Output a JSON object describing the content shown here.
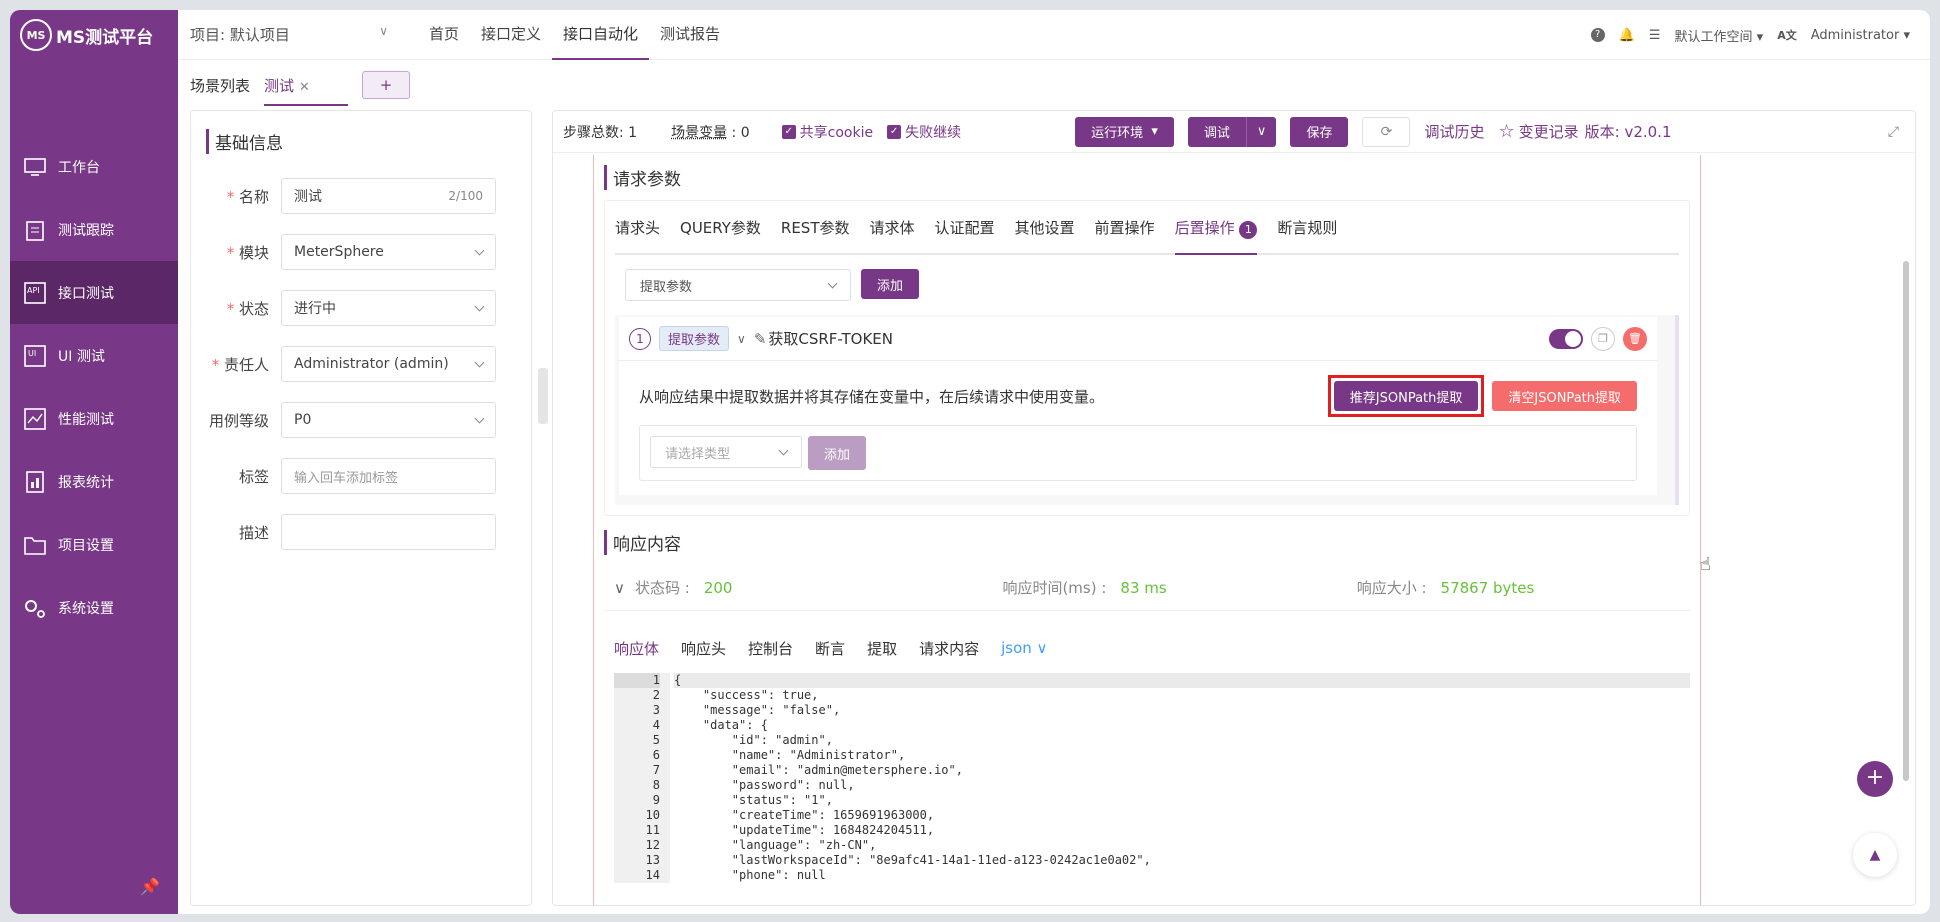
{
  "app": {
    "logo_text": "MS测试平台",
    "logo_mark": "MS"
  },
  "sidebar": {
    "items": [
      {
        "label": "工作台",
        "icon": "monitor-icon"
      },
      {
        "label": "测试跟踪",
        "icon": "clipboard-icon"
      },
      {
        "label": "接口测试",
        "icon": "api-icon"
      },
      {
        "label": "UI 测试",
        "icon": "ui-icon"
      },
      {
        "label": "性能测试",
        "icon": "chart-icon"
      },
      {
        "label": "报表统计",
        "icon": "report-icon"
      },
      {
        "label": "项目设置",
        "icon": "folder-icon"
      },
      {
        "label": "系统设置",
        "icon": "gear-icon"
      }
    ],
    "active_index": 2
  },
  "topbar": {
    "project": "项目: 默认项目",
    "menu": [
      "首页",
      "接口定义",
      "接口自动化",
      "测试报告"
    ],
    "active_menu": 2,
    "workspace": "默认工作空间",
    "user": "Administrator"
  },
  "scene_tabs": {
    "list_label": "场景列表",
    "tab": "测试",
    "add": "+"
  },
  "basic_info": {
    "title": "基础信息",
    "name_label": "名称",
    "name_value": "测试",
    "name_count": "2/100",
    "module_label": "模块",
    "module_value": "MeterSphere",
    "status_label": "状态",
    "status_value": "进行中",
    "owner_label": "责任人",
    "owner_value": "Administrator (admin)",
    "level_label": "用例等级",
    "level_value": "P0",
    "tag_label": "标签",
    "tag_placeholder": "输入回车添加标签",
    "desc_label": "描述"
  },
  "toolbar": {
    "steps_label": "步骤总数:",
    "steps_value": "1",
    "vars_label": "场景变量",
    "vars_sep": ":",
    "vars_value": "0",
    "share_cookie": "共享cookie",
    "fail_continue": "失败继续",
    "env_button": "运行环境",
    "debug_button": "调试",
    "save_button": "保存",
    "history_link": "调试历史",
    "changes_link": "变更记录",
    "version": "版本: v2.0.1"
  },
  "request": {
    "section_title": "请求参数",
    "tabs": [
      "请求头",
      "QUERY参数",
      "REST参数",
      "请求体",
      "认证配置",
      "其他设置",
      "前置操作",
      "后置操作",
      "断言规则"
    ],
    "active_tab": 7,
    "post_badge": "1",
    "extract_select": "提取参数",
    "add_button": "添加",
    "step": {
      "index": "1",
      "tag": "提取参数",
      "name": "获取CSRF-TOKEN",
      "description": "从响应结果中提取数据并将其存储在变量中，在后续请求中使用变量。",
      "recommend_button": "推荐JSONPath提取",
      "clear_button": "清空JSONPath提取",
      "type_placeholder": "请选择类型",
      "add_button": "添加"
    }
  },
  "response": {
    "section_title": "响应内容",
    "status_label": "状态码 :",
    "status_value": "200",
    "time_label": "响应时间(ms) :",
    "time_value": "83 ms",
    "size_label": "响应大小 :",
    "size_value": "57867 bytes",
    "tabs": [
      "响应体",
      "响应头",
      "控制台",
      "断言",
      "提取",
      "请求内容"
    ],
    "format": "json",
    "line_numbers": [
      "1",
      "2",
      "3",
      "4",
      "5",
      "6",
      "7",
      "8",
      "9",
      "10",
      "11",
      "12",
      "13",
      "14"
    ],
    "code_lines": [
      "{",
      "    \"success\": true,",
      "    \"message\": \"false\",",
      "    \"data\": {",
      "        \"id\": \"admin\",",
      "        \"name\": \"Administrator\",",
      "        \"email\": \"admin@metersphere.io\",",
      "        \"password\": null,",
      "        \"status\": \"1\",",
      "        \"createTime\": 1659691963000,",
      "        \"updateTime\": 1684824204511,",
      "        \"language\": \"zh-CN\",",
      "        \"lastWorkspaceId\": \"8e9afc41-14a1-11ed-a123-0242ac1e0a02\",",
      "        \"phone\": null"
    ]
  },
  "colors": {
    "brand": "#783887",
    "success": "#67c23a",
    "danger": "#f56c6c"
  }
}
